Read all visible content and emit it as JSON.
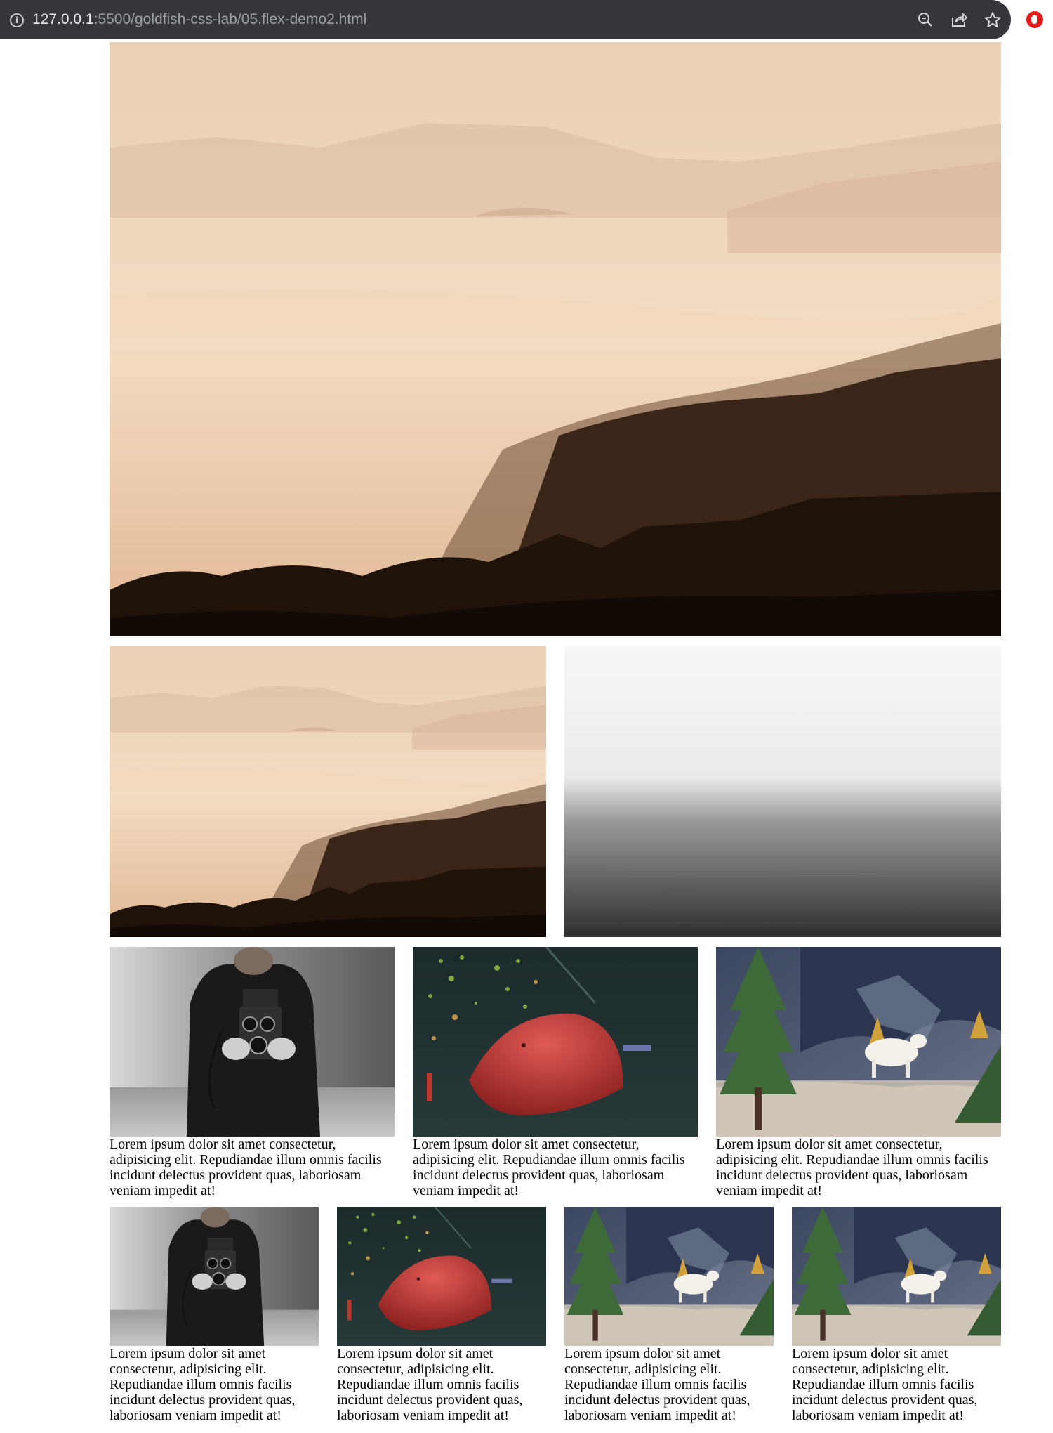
{
  "browser": {
    "url_host": "127.0.0.1",
    "url_rest": ":5500/goldfish-css-lab/05.flex-demo2.html",
    "icons": [
      "info-icon",
      "zoom-icon",
      "share-icon",
      "bookmark-star-icon",
      "extension-stop-icon"
    ]
  },
  "images": {
    "hero": "misty-mountains-sunrise",
    "row2": [
      "misty-mountains-sunrise",
      "foggy-sea-monochrome"
    ],
    "row3": [
      "man-with-vintage-camera",
      "red-umbrella-night-street",
      "mountain-goat-forest"
    ],
    "row4": [
      "man-with-vintage-camera",
      "red-umbrella-night-street",
      "mountain-goat-forest",
      "mountain-goat-forest"
    ]
  },
  "cards": {
    "row3": [
      {
        "text": "Lorem ipsum dolor sit amet consectetur, adipisicing elit. Repudiandae illum omnis facilis incidunt delectus provident quas, laboriosam veniam impedit at!"
      },
      {
        "text": "Lorem ipsum dolor sit amet consectetur, adipisicing elit. Repudiandae illum omnis facilis incidunt delectus provident quas, laboriosam veniam impedit at!"
      },
      {
        "text": "Lorem ipsum dolor sit amet consectetur, adipisicing elit. Repudiandae illum omnis facilis incidunt delectus provident quas, laboriosam veniam impedit at!"
      }
    ],
    "row4": [
      {
        "text": "Lorem ipsum dolor sit amet consectetur, adipisicing elit. Repudiandae illum omnis facilis incidunt delectus provident quas, laboriosam veniam impedit at!"
      },
      {
        "text": "Lorem ipsum dolor sit amet consectetur, adipisicing elit. Repudiandae illum omnis facilis incidunt delectus provident quas, laboriosam veniam impedit at!"
      },
      {
        "text": "Lorem ipsum dolor sit amet consectetur, adipisicing elit. Repudiandae illum omnis facilis incidunt delectus provident quas, laboriosam veniam impedit at!"
      },
      {
        "text": "Lorem ipsum dolor sit amet consectetur, adipisicing elit. Repudiandae illum omnis facilis incidunt delectus provident quas, laboriosam veniam impedit at!"
      }
    ]
  },
  "colors": {
    "bar_bg": "#35363a",
    "url_host": "#e8eaed",
    "url_rest": "#9aa0a6",
    "ext_red": "#e41b1b"
  }
}
